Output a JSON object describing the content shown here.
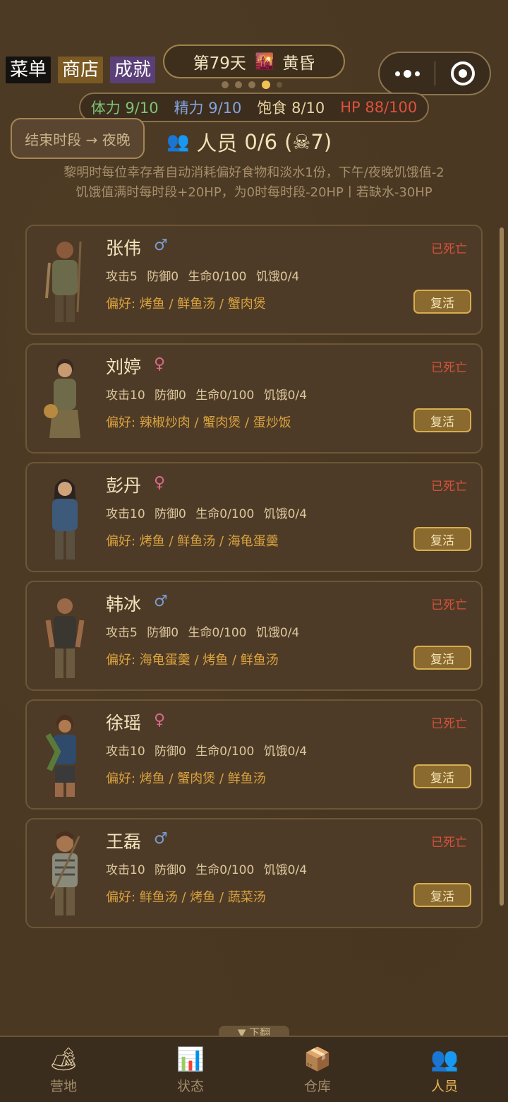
{
  "top_menu": {
    "menu": "菜单",
    "shop": "商店",
    "achievements": "成就"
  },
  "day": {
    "label": "第79天",
    "phase": "黄昏"
  },
  "stats": {
    "stamina": "体力 9/10",
    "spirit": "精力 9/10",
    "food": "饱食 8/10",
    "hp": "HP 88/100"
  },
  "end_period_button": "结束时段 → 夜晚",
  "people": {
    "title": "人员",
    "count": "0/6",
    "deaths": "(☠7)"
  },
  "rules": {
    "line1": "黎明时每位幸存者自动消耗偏好食物和淡水1份，下午/夜晚饥饿值-2",
    "line2": "饥饿值满时每时段+20HP，为0时每时段-20HP丨若缺水-30HP"
  },
  "survivors": [
    {
      "name": "张伟",
      "gender": "♂",
      "status": "已死亡",
      "attack": "攻击5",
      "defense": "防御0",
      "life": "生命0/100",
      "hunger": "饥饿0/4",
      "prefs": "偏好: 烤鱼 / 鲜鱼汤 / 蟹肉煲",
      "revive": "复活"
    },
    {
      "name": "刘婷",
      "gender": "♀",
      "status": "已死亡",
      "attack": "攻击10",
      "defense": "防御0",
      "life": "生命0/100",
      "hunger": "饥饿0/4",
      "prefs": "偏好: 辣椒炒肉 / 蟹肉煲 / 蛋炒饭",
      "revive": "复活"
    },
    {
      "name": "彭丹",
      "gender": "♀",
      "status": "已死亡",
      "attack": "攻击10",
      "defense": "防御0",
      "life": "生命0/100",
      "hunger": "饥饿0/4",
      "prefs": "偏好: 烤鱼 / 鲜鱼汤 / 海龟蛋羹",
      "revive": "复活"
    },
    {
      "name": "韩冰",
      "gender": "♂",
      "status": "已死亡",
      "attack": "攻击5",
      "defense": "防御0",
      "life": "生命0/100",
      "hunger": "饥饿0/4",
      "prefs": "偏好: 海龟蛋羹 / 烤鱼 / 鲜鱼汤",
      "revive": "复活"
    },
    {
      "name": "徐瑶",
      "gender": "♀",
      "status": "已死亡",
      "attack": "攻击10",
      "defense": "防御0",
      "life": "生命0/100",
      "hunger": "饥饿0/4",
      "prefs": "偏好: 烤鱼 / 蟹肉煲 / 鲜鱼汤",
      "revive": "复活"
    },
    {
      "name": "王磊",
      "gender": "♂",
      "status": "已死亡",
      "attack": "攻击10",
      "defense": "防御0",
      "life": "生命0/100",
      "hunger": "饥饿0/4",
      "prefs": "偏好: 鲜鱼汤 / 烤鱼 / 蔬菜汤",
      "revive": "复活"
    }
  ],
  "pagedown": "▼ 下翻",
  "tabs": [
    {
      "label": "营地",
      "icon": "camp-icon"
    },
    {
      "label": "状态",
      "icon": "chart-icon"
    },
    {
      "label": "仓库",
      "icon": "box-icon"
    },
    {
      "label": "人员",
      "icon": "people-icon"
    }
  ],
  "active_tab": "人员"
}
